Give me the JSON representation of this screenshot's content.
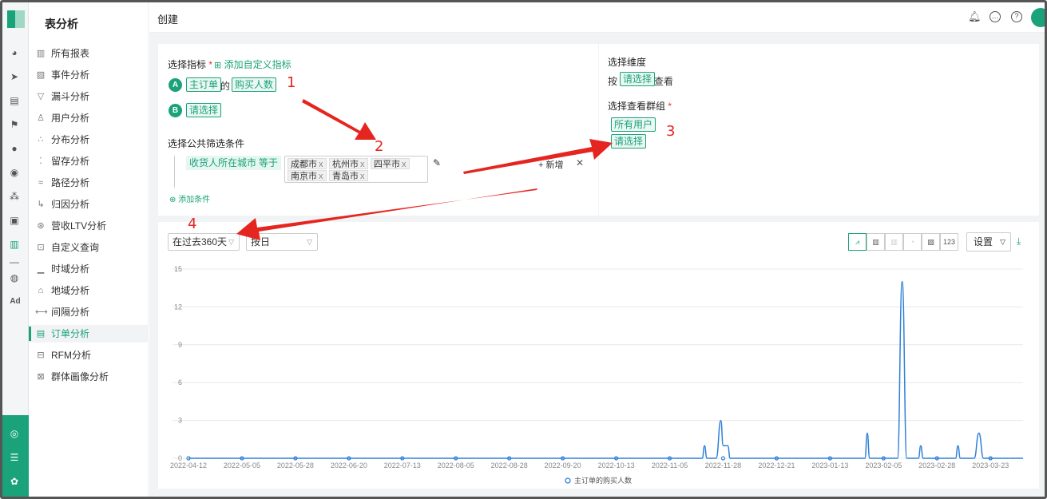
{
  "app": {
    "section_title": "表分析",
    "page_title": "创建"
  },
  "sidebar": {
    "items": [
      {
        "label": "所有报表",
        "icon": "bar-chart-icon"
      },
      {
        "label": "事件分析",
        "icon": "event-icon"
      },
      {
        "label": "漏斗分析",
        "icon": "funnel-icon"
      },
      {
        "label": "用户分析",
        "icon": "user-icon"
      },
      {
        "label": "分布分析",
        "icon": "distribution-icon"
      },
      {
        "label": "留存分析",
        "icon": "retention-icon"
      },
      {
        "label": "路径分析",
        "icon": "path-icon"
      },
      {
        "label": "归因分析",
        "icon": "attribution-icon"
      },
      {
        "label": "营收LTV分析",
        "icon": "revenue-icon"
      },
      {
        "label": "自定义查询",
        "icon": "query-icon"
      },
      {
        "label": "时域分析",
        "icon": "time-icon"
      },
      {
        "label": "地域分析",
        "icon": "map-icon"
      },
      {
        "label": "间隔分析",
        "icon": "interval-icon"
      },
      {
        "label": "订单分析",
        "icon": "order-icon",
        "active": true
      },
      {
        "label": "RFM分析",
        "icon": "rfm-icon"
      },
      {
        "label": "群体画像分析",
        "icon": "portrait-icon"
      }
    ]
  },
  "metrics": {
    "label": "选择指标",
    "add_custom": "添加自定义指标",
    "a_badge": "A",
    "a_source": "主订单",
    "a_of": "的",
    "a_metric": "购买人数",
    "b_badge": "B",
    "b_placeholder": "请选择"
  },
  "filters": {
    "label": "选择公共筛选条件",
    "field": "收货人所在城市",
    "operator": "等于",
    "cities": [
      "成都市",
      "杭州市",
      "四平市",
      "南京市",
      "青岛市"
    ],
    "add_new": "新增",
    "add_condition": "添加条件"
  },
  "dimension": {
    "label": "选择维度",
    "prefix": "按",
    "placeholder": "请选择",
    "suffix": "查看",
    "group_label": "选择查看群组",
    "group_all": "所有用户",
    "group_placeholder": "请选择"
  },
  "chart_controls": {
    "date_range": "在过去360天",
    "granularity": "按日",
    "settings": "设置",
    "number_view": "123"
  },
  "annotations": [
    "1",
    "2",
    "3",
    "4"
  ],
  "colors": {
    "accent": "#1aa37a",
    "line": "#2f80d8",
    "annotation": "#e52520"
  },
  "chart_data": {
    "type": "line",
    "x_tick_labels": [
      "2022-04-12",
      "2022-05-05",
      "2022-05-28",
      "2022-06-20",
      "2022-07-13",
      "2022-08-05",
      "2022-08-28",
      "2022-09-20",
      "2022-10-13",
      "2022-11-05",
      "2022-11-28",
      "2022-12-21",
      "2023-01-13",
      "2023-02-05",
      "2023-02-28",
      "2023-03-23"
    ],
    "y_ticks": [
      0,
      3,
      6,
      9,
      12,
      15
    ],
    "ylim": [
      0,
      15
    ],
    "xlim": [
      "2022-04-12",
      "2023-04-06"
    ],
    "grid": true,
    "legend_position": "bottom",
    "series": [
      {
        "name": "主订单的购买人数",
        "points": [
          [
            "2022-04-12",
            0
          ],
          [
            "2022-11-19",
            0
          ],
          [
            "2022-11-20",
            1
          ],
          [
            "2022-11-21",
            0
          ],
          [
            "2022-11-25",
            0
          ],
          [
            "2022-11-27",
            3
          ],
          [
            "2022-11-28",
            1
          ],
          [
            "2022-11-30",
            1
          ],
          [
            "2022-12-01",
            0
          ],
          [
            "2023-01-28",
            0
          ],
          [
            "2023-01-29",
            2
          ],
          [
            "2023-01-30",
            0
          ],
          [
            "2023-02-11",
            0
          ],
          [
            "2023-02-13",
            14
          ],
          [
            "2023-02-15",
            0
          ],
          [
            "2023-02-20",
            0
          ],
          [
            "2023-02-21",
            1
          ],
          [
            "2023-02-22",
            0
          ],
          [
            "2023-03-08",
            0
          ],
          [
            "2023-03-09",
            1
          ],
          [
            "2023-03-10",
            0
          ],
          [
            "2023-03-16",
            0
          ],
          [
            "2023-03-18",
            2
          ],
          [
            "2023-03-20",
            0
          ],
          [
            "2023-04-06",
            0
          ]
        ]
      }
    ]
  }
}
